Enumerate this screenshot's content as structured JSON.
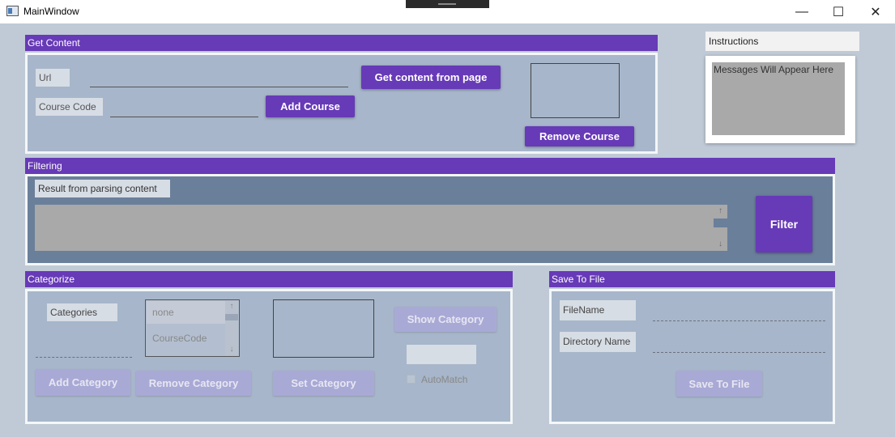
{
  "window": {
    "title": "MainWindow",
    "minimize": "—",
    "maximize": "☐",
    "close": "✕"
  },
  "get_content": {
    "header": "Get Content",
    "url_label": "Url",
    "url_value": "",
    "course_code_label": "Course Code",
    "course_code_value": "",
    "get_content_button": "Get content from page",
    "add_course_button": "Add Course",
    "remove_course_button": "Remove Course"
  },
  "instructions": {
    "header": "Instructions",
    "message": "Messages Will Appear Here"
  },
  "filtering": {
    "header": "Filtering",
    "result_label": "Result from parsing content",
    "result_value": "",
    "filter_button": "Filter"
  },
  "categorize": {
    "header": "Categorize",
    "categories_label": "Categories",
    "list_items": [
      "none",
      "CourseCode"
    ],
    "show_category_button": "Show Category",
    "add_category_button": "Add Category",
    "remove_category_button": "Remove Category",
    "set_category_button": "Set Category",
    "automatch_label": "AutoMatch"
  },
  "save_to_file": {
    "header": "Save To File",
    "filename_label": "FileName",
    "directory_label": "Directory Name",
    "save_button": "Save To File"
  }
}
